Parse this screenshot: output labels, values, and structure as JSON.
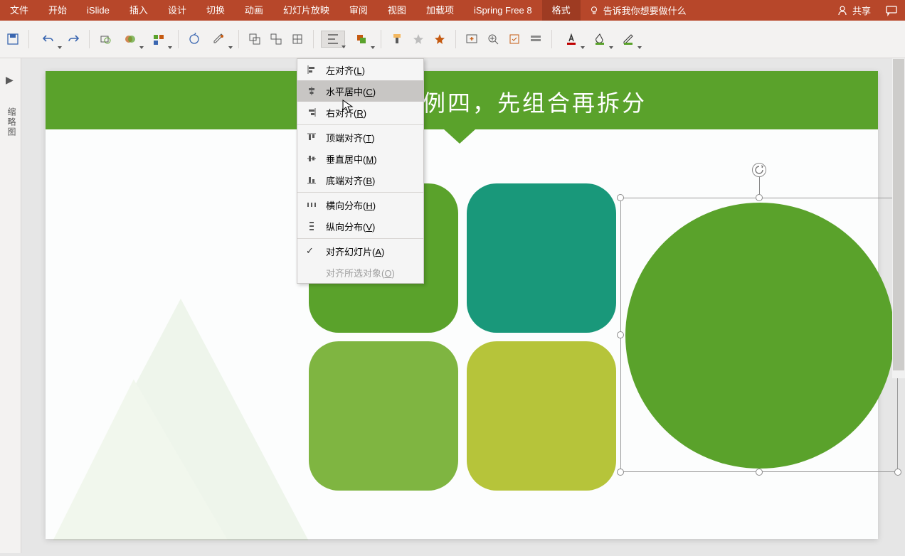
{
  "ribbon": {
    "tabs": [
      "文件",
      "开始",
      "iSlide",
      "插入",
      "设计",
      "切换",
      "动画",
      "幻灯片放映",
      "审阅",
      "视图",
      "加载项",
      "iSpring Free 8",
      "格式"
    ],
    "active_tab": "格式",
    "tell_me": "告诉我你想要做什么",
    "share": "共享"
  },
  "left_panel": {
    "label": "缩略图"
  },
  "slide": {
    "title": "例四，先组合再拆分"
  },
  "align_menu": {
    "items": [
      {
        "label": "左对齐(",
        "accel": "L",
        "suffix": ")"
      },
      {
        "label": "水平居中(",
        "accel": "C",
        "suffix": ")"
      },
      {
        "label": "右对齐(",
        "accel": "R",
        "suffix": ")"
      },
      {
        "label": "顶端对齐(",
        "accel": "T",
        "suffix": ")"
      },
      {
        "label": "垂直居中(",
        "accel": "M",
        "suffix": ")"
      },
      {
        "label": "底端对齐(",
        "accel": "B",
        "suffix": ")"
      },
      {
        "label": "横向分布(",
        "accel": "H",
        "suffix": ")"
      },
      {
        "label": "纵向分布(",
        "accel": "V",
        "suffix": ")"
      },
      {
        "label": "对齐幻灯片(",
        "accel": "A",
        "suffix": ")"
      },
      {
        "label": "对齐所选对象(",
        "accel": "O",
        "suffix": ")"
      }
    ]
  }
}
